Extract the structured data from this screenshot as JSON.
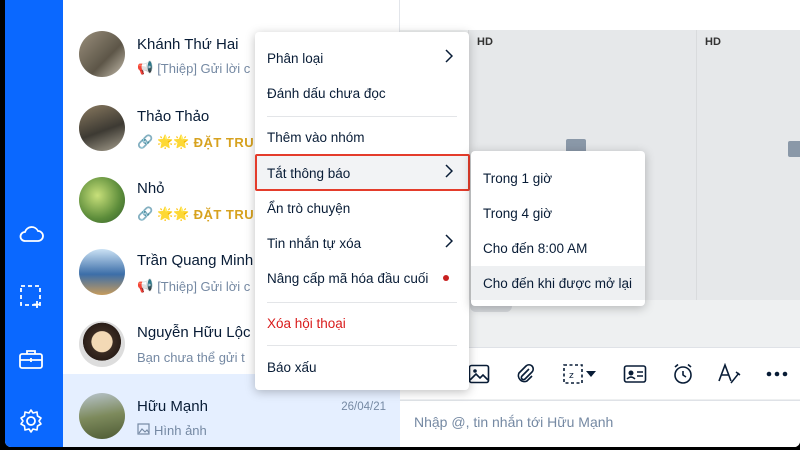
{
  "rail": {
    "icons": [
      "cloud-icon",
      "screenshot-icon",
      "briefcase-icon",
      "gear-icon"
    ]
  },
  "conversations": [
    {
      "name": "Khánh Thứ Hai",
      "preview": "[Thiệp] Gửi lời c",
      "preview_icon": "megaphone-icon",
      "time": ""
    },
    {
      "name": "Thảo Thảo",
      "preview_prefix": "🌟🌟",
      "preview": "ĐẶT TRU",
      "preview_icon": "link-icon",
      "time": ""
    },
    {
      "name": "Nhỏ",
      "preview_prefix": "🌟🌟",
      "preview": "ĐẶT TRU",
      "preview_icon": "link-icon",
      "time": ""
    },
    {
      "name": "Trần Quang Minh",
      "preview": "[Thiệp] Gửi lời c",
      "preview_icon": "megaphone-icon",
      "time": ""
    },
    {
      "name": "Nguyễn Hữu Lộc",
      "preview": "Bạn chưa thể gửi t",
      "preview_icon": "",
      "time": ""
    },
    {
      "name": "Hữu Mạnh",
      "preview": "Hình ảnh",
      "preview_icon": "image-icon",
      "time": "26/04/21"
    }
  ],
  "chat": {
    "media_badges": [
      "HD",
      "HD"
    ],
    "composer_placeholder": "Nhập @, tin nhắn tới Hữu Mạnh",
    "toolbar_icons": [
      "image-icon",
      "paperclip-icon",
      "screenshot-icon",
      "chevron-down-icon",
      "contact-card-icon",
      "alarm-icon",
      "text-format-icon",
      "more-icon"
    ]
  },
  "context_menu": {
    "items": [
      {
        "label": "Phân loại",
        "has_submenu": true
      },
      {
        "label": "Đánh dấu chưa đọc",
        "has_submenu": false
      },
      {
        "label": "Thêm vào nhóm",
        "has_submenu": false
      },
      {
        "label": "Tắt thông báo",
        "has_submenu": true,
        "highlighted": true
      },
      {
        "label": "Ẩn trò chuyện",
        "has_submenu": false
      },
      {
        "label": "Tin nhắn tự xóa",
        "has_submenu": true
      },
      {
        "label": "Nâng cấp mã hóa đầu cuối",
        "has_submenu": false,
        "badge_dot": true
      },
      {
        "label": "Xóa hội thoại",
        "has_submenu": false,
        "danger": true
      },
      {
        "label": "Báo xấu",
        "has_submenu": false
      }
    ]
  },
  "mute_submenu": {
    "items": [
      {
        "label": "Trong 1 giờ"
      },
      {
        "label": "Trong 4 giờ"
      },
      {
        "label": "Cho đến 8:00 AM"
      },
      {
        "label": "Cho đến khi được mở lại",
        "highlighted": true
      }
    ]
  },
  "colors": {
    "rail": "#0a68ff",
    "active_row": "#e5efff",
    "danger": "#d91b1b",
    "focus_outline": "#e43c2b",
    "dot": "#c8201f"
  }
}
